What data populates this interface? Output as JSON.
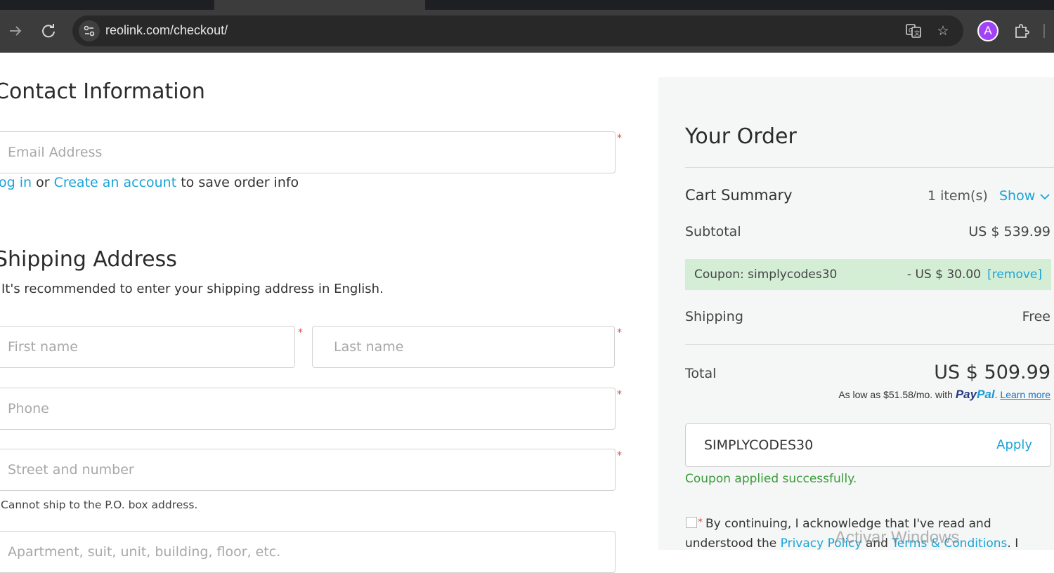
{
  "browser": {
    "url": "reolink.com/checkout/",
    "profile_initial": "A"
  },
  "contact": {
    "title": "Contact Information",
    "email_placeholder": "Email Address",
    "login_link": "og in",
    "or_text": "or",
    "create_link": "Create an account",
    "save_text": "to save order info"
  },
  "shipping": {
    "title": "Shipping Address",
    "subtitle": "It's recommended to enter your shipping address in English.",
    "first_name_placeholder": "First name",
    "last_name_placeholder": "Last name",
    "phone_placeholder": "Phone",
    "street_placeholder": "Street and number",
    "po_note": "Cannot ship to the P.O. box address.",
    "apartment_placeholder": "Apartment, suit, unit, building, floor, etc."
  },
  "order": {
    "title": "Your Order",
    "cart_summary_label": "Cart Summary",
    "item_count": "1 item(s)",
    "show_label": "Show",
    "subtotal_label": "Subtotal",
    "subtotal_value": "US $ 539.99",
    "coupon_label": "Coupon: simplycodes30",
    "coupon_discount": "- US $ 30.00",
    "coupon_remove": "[remove]",
    "shipping_label": "Shipping",
    "shipping_value": "Free",
    "total_label": "Total",
    "total_value": "US $ 509.99",
    "paypal_prefix": "As low as $51.58/mo. with",
    "paypal_brand_pay": "Pay",
    "paypal_brand_pal": "Pal",
    "paypal_learn": "Learn more",
    "coupon_code_value": "SIMPLYCODES30",
    "apply_label": "Apply",
    "coupon_success": "Coupon applied successfully.",
    "terms_text": "By continuing, I acknowledge that I've read and",
    "terms_line2_prefix": "understood the",
    "privacy_link": "Privacy Policy",
    "and_text": "and",
    "terms_link": "Terms & Conditions",
    "terms_tail": ". I"
  },
  "os": {
    "watermark": "Activar Windows"
  },
  "colors": {
    "link": "#1aa3d8",
    "required": "#d9534f",
    "success": "#3a9a3a",
    "coupon_bg": "#d4edd5",
    "panel_bg": "#f5f6f6",
    "paypal_dark": "#253b80",
    "paypal_light": "#179bd7"
  },
  "icons": [
    "forward-arrow-icon",
    "reload-icon",
    "site-info-icon",
    "translate-icon",
    "bookmark-star-icon",
    "profile-avatar",
    "extensions-icon",
    "chevron-down-icon"
  ]
}
